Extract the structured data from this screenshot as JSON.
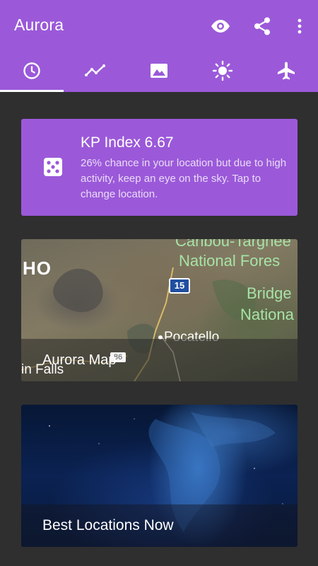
{
  "appbar": {
    "title": "Aurora",
    "actions": [
      "eye-icon",
      "share-icon",
      "more-vert-icon"
    ],
    "color": "#9b59d9"
  },
  "tabs": [
    {
      "icon": "clock-icon",
      "selected": true
    },
    {
      "icon": "trend-icon",
      "selected": false
    },
    {
      "icon": "image-icon",
      "selected": false
    },
    {
      "icon": "sun-icon",
      "selected": false
    },
    {
      "icon": "airplane-icon",
      "selected": false
    }
  ],
  "kp_card": {
    "title": "KP Index 6.67",
    "description": "26% chance in your location but due to high activity, keep an eye on the sky. Tap to change location.",
    "icon": "dice-icon"
  },
  "map_card": {
    "title": "Aurora Map",
    "labels": {
      "state": "HO",
      "forest1": "Caribou-Targhee",
      "forest2": "National Fores",
      "highway": "15",
      "city": "Pocatello",
      "bridge1": "Bridge",
      "bridge2": "Nationa",
      "falls": "in Falls",
      "route": "86"
    }
  },
  "locations_card": {
    "title": "Best Locations Now"
  }
}
